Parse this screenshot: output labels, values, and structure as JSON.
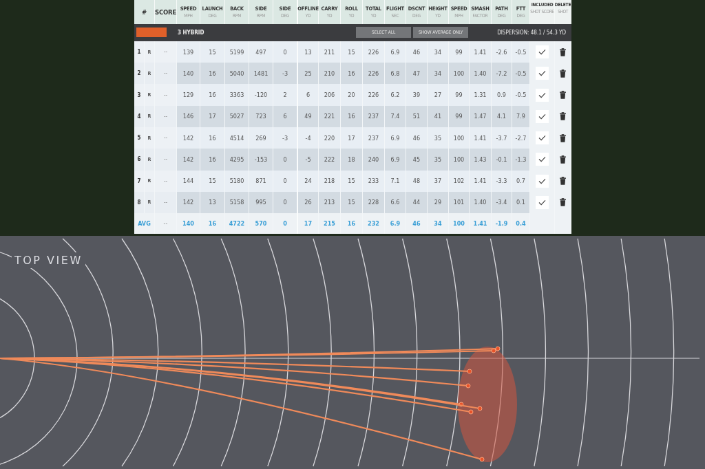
{
  "table": {
    "header": {
      "number": "#",
      "score": "SCORE",
      "columns": [
        {
          "label": "SPEED",
          "unit": "MPH"
        },
        {
          "label": "LAUNCH",
          "unit": "DEG"
        },
        {
          "label": "BACK",
          "unit": "RPM"
        },
        {
          "label": "SIDE",
          "unit": "RPM"
        },
        {
          "label": "SIDE",
          "unit": "DEG"
        },
        {
          "label": "OFFLINE",
          "unit": "YD"
        },
        {
          "label": "CARRY",
          "unit": "YD"
        },
        {
          "label": "ROLL",
          "unit": "YD"
        },
        {
          "label": "TOTAL",
          "unit": "YD"
        },
        {
          "label": "FLIGHT",
          "unit": "SEC"
        },
        {
          "label": "DSCNT",
          "unit": "DEG"
        },
        {
          "label": "HEIGHT",
          "unit": "YD"
        },
        {
          "label": "SPEED",
          "unit": "MPH"
        },
        {
          "label": "SMASH",
          "unit": "FACTOR"
        },
        {
          "label": "PATH",
          "unit": "DEG"
        },
        {
          "label": "FTT",
          "unit": "DEG"
        }
      ],
      "included": {
        "label": "INCLUDED",
        "unit": "SHOT SCORE"
      },
      "delete": {
        "label": "DELETE",
        "unit": "SHOT"
      }
    },
    "club_bar": {
      "color": "#e0602a",
      "club": "3 HYBRID",
      "buttons": [
        "SELECT ALL",
        "SHOW AVERAGE ONLY"
      ],
      "dispersion": "DISPERSION: 48.1 / 54.3 YD"
    },
    "rows": [
      {
        "number": "1",
        "hand": "R",
        "score": "--",
        "values": [
          "139",
          "15",
          "5199",
          "497",
          "0",
          "13",
          "211",
          "15",
          "226",
          "6.9",
          "46",
          "34",
          "99",
          "1.41",
          "-2.6",
          "-0.5"
        ],
        "included": true
      },
      {
        "number": "2",
        "hand": "R",
        "score": "--",
        "values": [
          "140",
          "16",
          "5040",
          "1481",
          "-3",
          "25",
          "210",
          "16",
          "226",
          "6.8",
          "47",
          "34",
          "100",
          "1.40",
          "-7.2",
          "-0.5"
        ],
        "included": true
      },
      {
        "number": "3",
        "hand": "R",
        "score": "--",
        "values": [
          "129",
          "16",
          "3363",
          "-120",
          "2",
          "6",
          "206",
          "20",
          "226",
          "6.2",
          "39",
          "27",
          "99",
          "1.31",
          "0.9",
          "-0.5"
        ],
        "included": true
      },
      {
        "number": "4",
        "hand": "R",
        "score": "--",
        "values": [
          "146",
          "17",
          "5027",
          "723",
          "6",
          "49",
          "221",
          "16",
          "237",
          "7.4",
          "51",
          "41",
          "99",
          "1.47",
          "4.1",
          "7.9"
        ],
        "included": true
      },
      {
        "number": "5",
        "hand": "R",
        "score": "--",
        "values": [
          "142",
          "16",
          "4514",
          "269",
          "-3",
          "-4",
          "220",
          "17",
          "237",
          "6.9",
          "46",
          "35",
          "100",
          "1.41",
          "-3.7",
          "-2.7"
        ],
        "included": true
      },
      {
        "number": "6",
        "hand": "R",
        "score": "--",
        "values": [
          "142",
          "16",
          "4295",
          "-153",
          "0",
          "-5",
          "222",
          "18",
          "240",
          "6.9",
          "45",
          "35",
          "100",
          "1.43",
          "-0.1",
          "-1.3"
        ],
        "included": true
      },
      {
        "number": "7",
        "hand": "R",
        "score": "--",
        "values": [
          "144",
          "15",
          "5180",
          "871",
          "0",
          "24",
          "218",
          "15",
          "233",
          "7.1",
          "48",
          "37",
          "102",
          "1.41",
          "-3.3",
          "0.7"
        ],
        "included": true
      },
      {
        "number": "8",
        "hand": "R",
        "score": "--",
        "values": [
          "142",
          "13",
          "5158",
          "995",
          "0",
          "26",
          "213",
          "15",
          "228",
          "6.6",
          "44",
          "29",
          "101",
          "1.40",
          "-3.4",
          "0.1"
        ],
        "included": true
      }
    ],
    "average": {
      "label": "AVG",
      "score": "--",
      "values": [
        "140",
        "16",
        "4722",
        "570",
        "0",
        "17",
        "215",
        "16",
        "232",
        "6.9",
        "46",
        "34",
        "100",
        "1.41",
        "-1.9",
        "0.4"
      ]
    }
  },
  "top_view": {
    "title": "TOP VIEW"
  }
}
